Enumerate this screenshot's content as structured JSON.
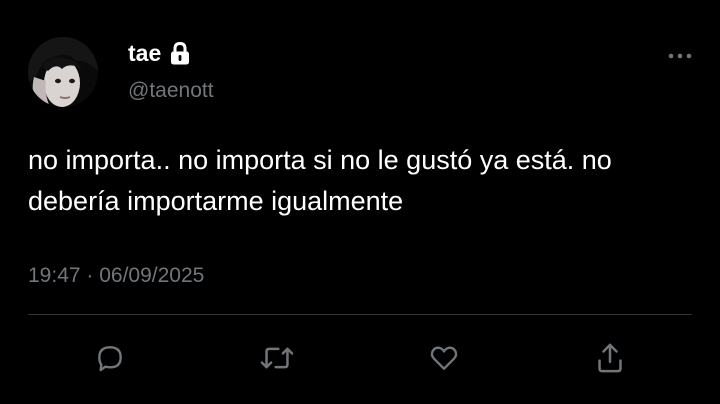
{
  "user": {
    "display_name": "tae",
    "handle": "@taenott",
    "verified_icon": "lock-icon"
  },
  "tweet": {
    "text": "no importa.. no importa si no le gustó ya está. no debería importarme igualmente",
    "timestamp": "19:47 · 06/09/2025"
  },
  "actions": {
    "icons": [
      "reply-icon",
      "retweet-icon",
      "like-icon",
      "share-icon"
    ]
  },
  "colors": {
    "background": "#000000",
    "text": "#ffffff",
    "muted": "#71767b",
    "divider": "#2f3336",
    "icon": "#71767b"
  }
}
